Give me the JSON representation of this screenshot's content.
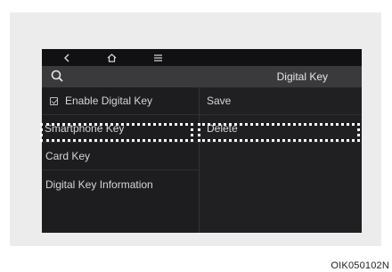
{
  "top_bar": {
    "back_icon": "chevron-left-icon",
    "home_icon": "home-icon",
    "menu_icon": "menu-icon"
  },
  "sub_bar": {
    "search_icon": "search-icon",
    "title": "Digital Key"
  },
  "left_menu": {
    "items": [
      {
        "label": "Enable Digital Key",
        "has_checkbox": true
      },
      {
        "label": "Smartphone Key"
      },
      {
        "label": "Card Key"
      },
      {
        "label": "Digital Key Information"
      }
    ]
  },
  "right_menu": {
    "items": [
      {
        "label": "Save"
      },
      {
        "label": "Delete"
      }
    ]
  },
  "caption": "OIK050102N",
  "colors": {
    "screen_bg": "#1b1b1d",
    "highlight": "#ffffff"
  }
}
